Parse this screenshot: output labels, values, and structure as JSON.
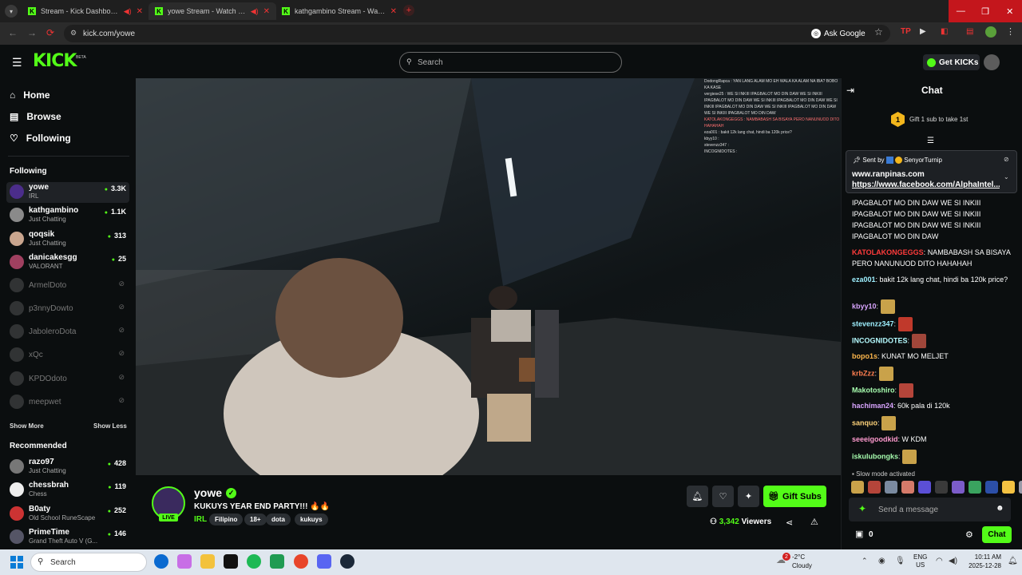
{
  "browser": {
    "tabs": [
      {
        "title": "Stream - Kick Dashboard"
      },
      {
        "title": "yowe Stream - Watch Live..."
      },
      {
        "title": "kathgambino Stream - Watch..."
      }
    ],
    "url": "kick.com/yowe",
    "ask_google": "Ask Google"
  },
  "header": {
    "logo": "KICK",
    "beta": "BETA",
    "search_placeholder": "Search",
    "get_kicks": "Get KICKs"
  },
  "sidebar": {
    "nav": [
      {
        "label": "Home",
        "icon": "home-icon"
      },
      {
        "label": "Browse",
        "icon": "browse-icon"
      },
      {
        "label": "Following",
        "icon": "heart-icon"
      }
    ],
    "following_title": "Following",
    "following": [
      {
        "name": "yowe",
        "category": "IRL",
        "viewers": "3.3K",
        "live": true,
        "color": "#4b2d8a"
      },
      {
        "name": "kathgambino",
        "category": "Just Chatting",
        "viewers": "1.1K",
        "live": true,
        "color": "#8a8a8a"
      },
      {
        "name": "qoqsik",
        "category": "Just Chatting",
        "viewers": "313",
        "live": true,
        "color": "#c9a58e"
      },
      {
        "name": "danicakesgg",
        "category": "VALORANT",
        "viewers": "25",
        "live": true,
        "color": "#a04060"
      },
      {
        "name": "ArmelDoto",
        "live": false
      },
      {
        "name": "p3nnyDowto",
        "live": false
      },
      {
        "name": "JaboleroDota",
        "live": false
      },
      {
        "name": "xQc",
        "live": false
      },
      {
        "name": "KPDOdoto",
        "live": false
      },
      {
        "name": "meepwet",
        "live": false
      }
    ],
    "show_more": "Show More",
    "show_less": "Show Less",
    "recommended_title": "Recommended",
    "recommended": [
      {
        "name": "razo97",
        "category": "Just Chatting",
        "viewers": "428",
        "color": "#777"
      },
      {
        "name": "chessbrah",
        "category": "Chess",
        "viewers": "119",
        "color": "#eee"
      },
      {
        "name": "B0aty",
        "category": "Old School RuneScape",
        "viewers": "252",
        "color": "#c33"
      },
      {
        "name": "PrimeTime",
        "category": "Grand Theft Auto V (G...",
        "viewers": "146",
        "color": "#556"
      }
    ]
  },
  "overlay_chat": [
    "DodongRapca : YAN LANG ALAM MO EH WALA KA ALAM NA IBA? BOBO KA KASE",
    "vergiese25 : WE SI INKIII IPAGBALOT MO DIN DAW WE SI INKIII IPAGBALOT MO DIN DAW WE SI INKIII IPAGBALOT MO DIN DAW WE SI INKIII IPAGBALOT MO DIN DAW WE SI INKIII IPAGBALOT MO DIN DAW WE SI INKIII IPAGBALOT MO DIN DAW",
    "KATOLAKONGEGGS : NAMBABASH SA BISAYA PERO NANUNUOD DITO HAHAHAH",
    "eza001 : bakit 12k lang chat, hindi ba 120k price?",
    "kbyy10 :",
    "stevenzz347 :",
    "INCOGNIDOTES :"
  ],
  "stream": {
    "name": "yowe",
    "live": "LIVE",
    "title": "KUKUYS YEAR END PARTY!!! 🔥🔥",
    "category": "IRL",
    "tags": [
      "Filipino",
      "18+",
      "dota",
      "kukuys"
    ],
    "viewers": "3,342",
    "viewers_label": "Viewers",
    "gift_subs": "Gift Subs"
  },
  "chat": {
    "title": "Chat",
    "gift_count": "1",
    "gift_text": "Gift 1 sub to take 1st",
    "pinned": {
      "sent_by": "Sent by",
      "user": "SenyorTurnip",
      "line1": "www.ranpinas.com",
      "line2": "https://www.facebook.com/AlphaIntel..."
    },
    "continuation": "IPAGBALOT MO DIN DAW WE SI INKIII IPAGBALOT MO DIN DAW WE SI INKIII IPAGBALOT MO DIN DAW WE SI INKIII IPAGBALOT MO DIN DAW",
    "messages": [
      {
        "user": "KATOLAKONGEGGS",
        "color": "#ff3b3b",
        "text": "NAMBABASH SA BISAYA PERO NANUNUOD DITO HAHAHAH"
      },
      {
        "user": "eza001",
        "color": "#9ef0ff",
        "text": "bakit 12k lang chat, hindi ba 120k price?"
      },
      {
        "user": "kbyy10",
        "color": "#d9a5ff",
        "text": "",
        "emote": "#c9a24a"
      },
      {
        "user": "stevenzz347",
        "color": "#9ef0ff",
        "text": "",
        "emote": "#c0392b"
      },
      {
        "user": "INCOGNIDOTES",
        "color": "#b5fbff",
        "text": "",
        "emote": "#a0463a"
      },
      {
        "user": "bopo1s",
        "color": "#ffb84d",
        "text": "KUNAT MO MELJET"
      },
      {
        "user": "krbZzz",
        "color": "#ff7f50",
        "text": "",
        "emote": "#c9a24a"
      },
      {
        "user": "Makotoshiro",
        "color": "#a8ffb0",
        "text": "",
        "emote": "#b5453a"
      },
      {
        "user": "hachiman24",
        "color": "#d9a5ff",
        "text": "60k pala di 120k"
      },
      {
        "user": "sanquo",
        "color": "#ffd37a",
        "text": "",
        "emote": "#c9a24a"
      },
      {
        "user": "seeeigoodkid",
        "color": "#ff9bcf",
        "text": "W KDM"
      },
      {
        "user": "iskulubongks",
        "color": "#a8ffb0",
        "text": "",
        "emote": "#c9a24a"
      }
    ],
    "slow_mode": "Slow mode activated",
    "emote_colors": [
      "#c9a24a",
      "#b5453a",
      "#7a8aa0",
      "#d57a6a",
      "#5b4fd6",
      "#3a3a3a",
      "#7b5cc9",
      "#3aa35f",
      "#2c4fa8",
      "#f4c242",
      "#9a9aa8"
    ],
    "input_placeholder": "Send a message",
    "kicks_count": "0",
    "send": "Chat"
  },
  "taskbar": {
    "search": "Search",
    "weather_temp": "-2°C",
    "weather_desc": "Cloudy",
    "weather_badge": "2",
    "lang": "ENG",
    "region": "US",
    "time": "10:11 AM",
    "date": "2025-12-28"
  }
}
